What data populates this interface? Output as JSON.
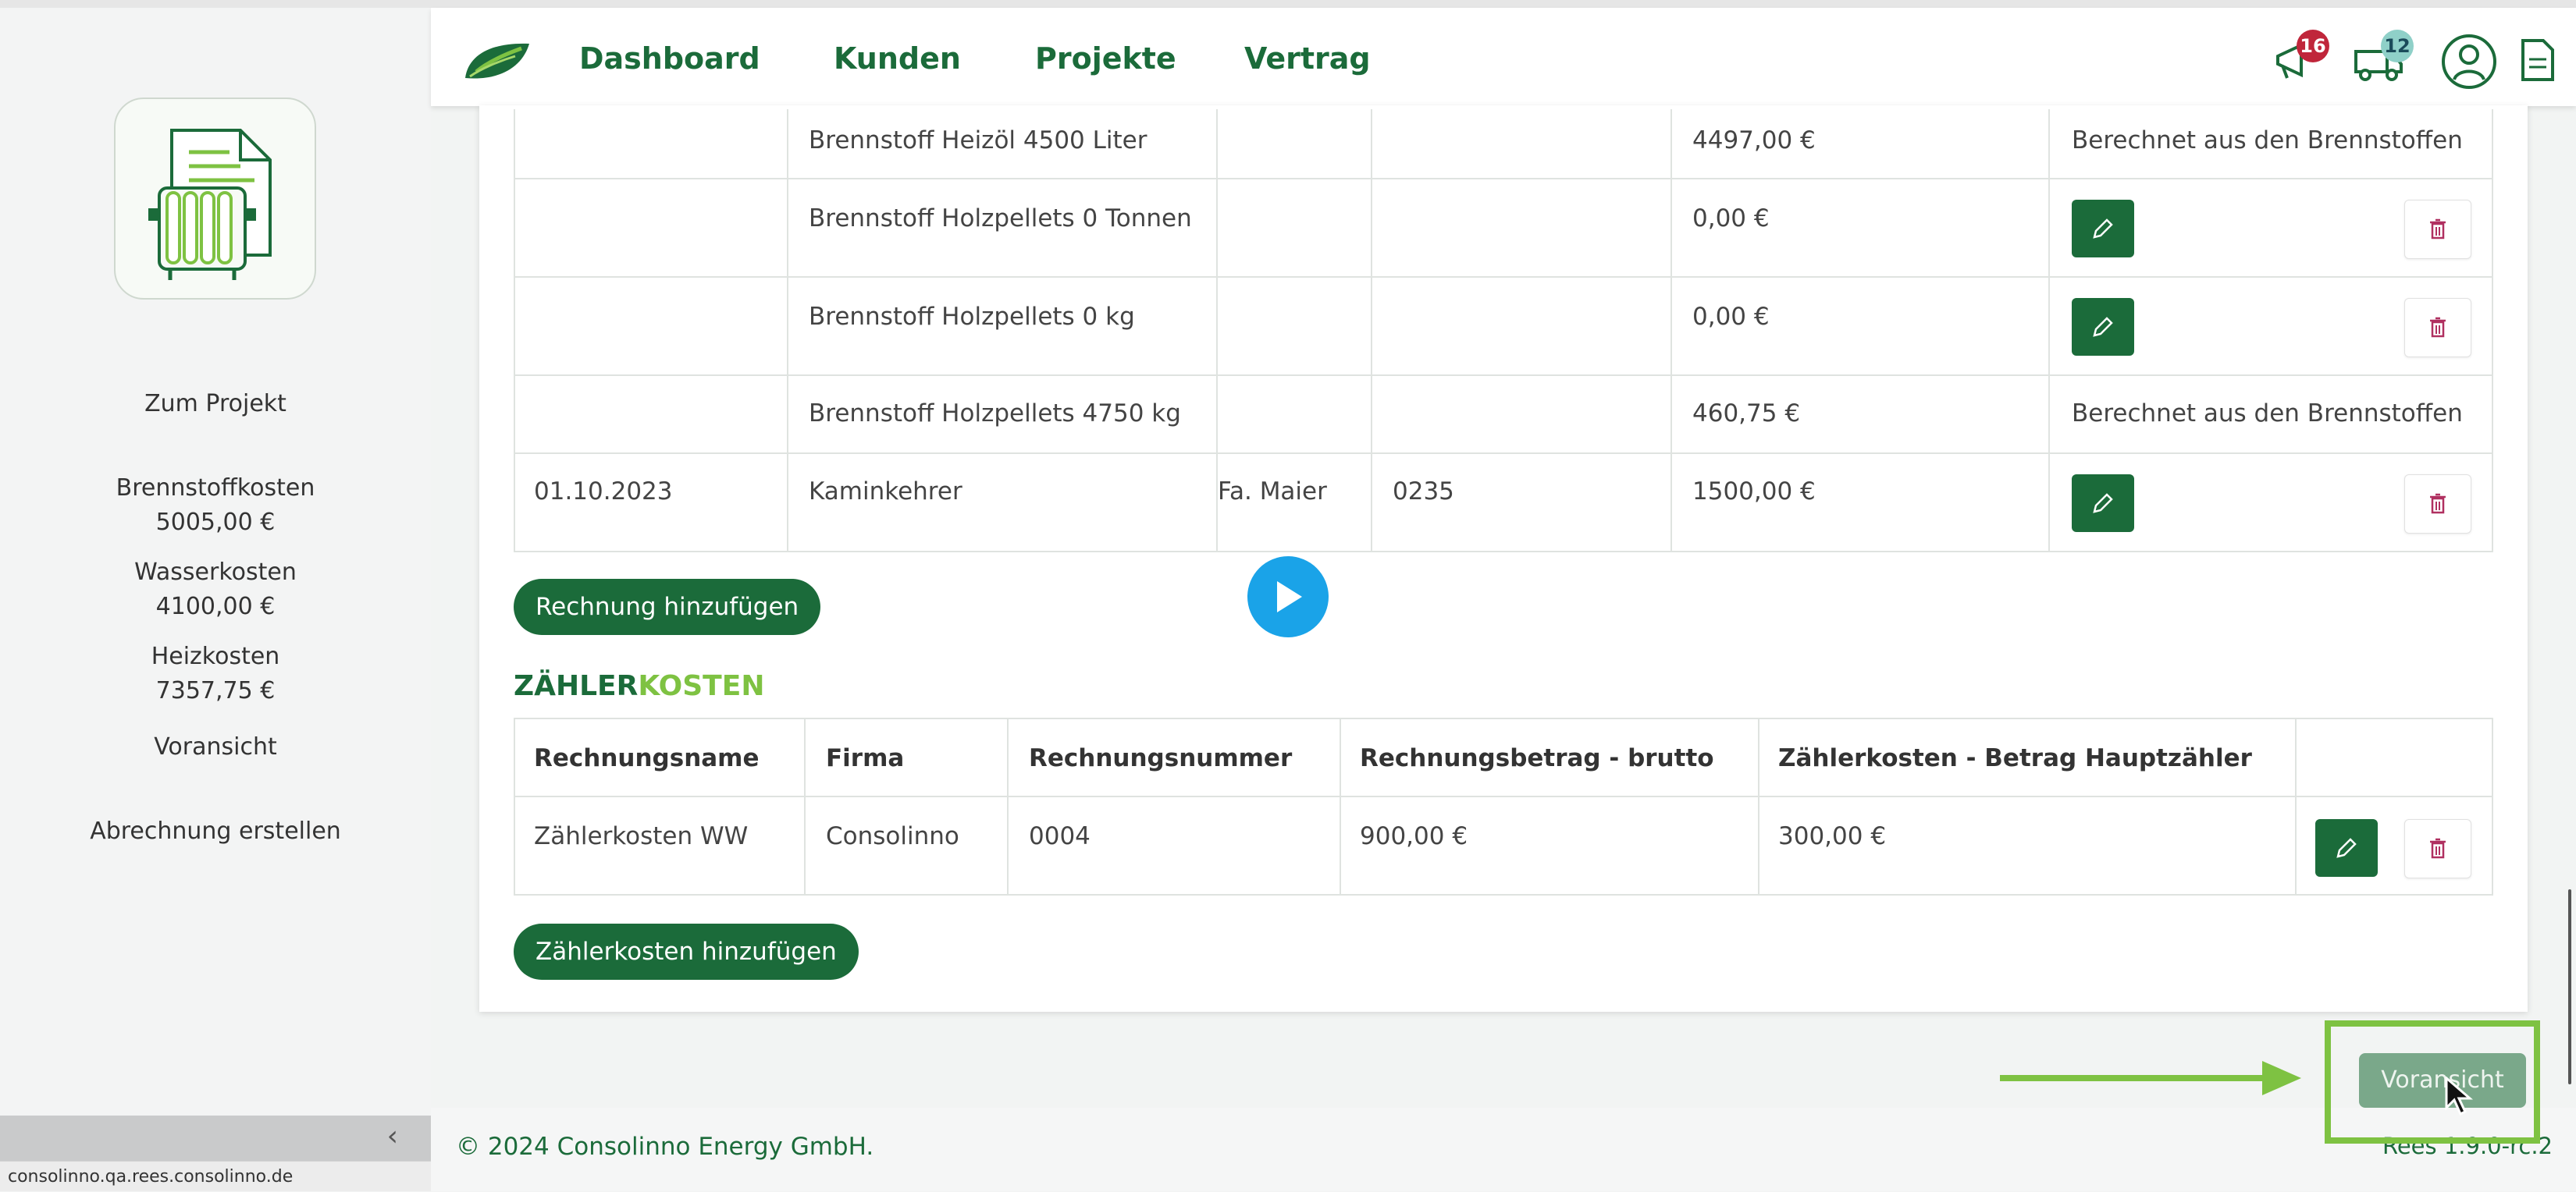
{
  "browser": {
    "status_url": "consolinno.qa.rees.consolinno.de"
  },
  "sidebar": {
    "items": [
      {
        "label": "Zum Projekt"
      },
      {
        "label": "Brennstoffkosten",
        "value": "5005,00 €"
      },
      {
        "label": "Wasserkosten",
        "value": "4100,00 €"
      },
      {
        "label": "Heizkosten",
        "value": "7357,75 €"
      },
      {
        "label": "Voransicht"
      },
      {
        "label": "Abrechnung erstellen"
      }
    ],
    "collapse_icon": "chevron-left-icon"
  },
  "navbar": {
    "links": [
      "Dashboard",
      "Kunden",
      "Projekte",
      "Vertrag"
    ],
    "notifications_count": "16",
    "tasks_count": "12",
    "colors": {
      "brand": "#1b6b3a",
      "accent": "#7ec242",
      "badge_red": "#c0263b",
      "badge_teal": "#5fb8b0"
    }
  },
  "invoices": {
    "rows": [
      {
        "date": "",
        "name": "Brennstoff Heizöl 4500 Liter",
        "firma": "",
        "nummer": "",
        "betrag": "4497,00 €",
        "note": "Berechnet aus den Brennstoffen",
        "editable": false
      },
      {
        "date": "",
        "name": "Brennstoff Holzpellets 0 Tonnen",
        "firma": "",
        "nummer": "",
        "betrag": "0,00 €",
        "note": "",
        "editable": true
      },
      {
        "date": "",
        "name": "Brennstoff Holzpellets 0 kg",
        "firma": "",
        "nummer": "",
        "betrag": "0,00 €",
        "note": "",
        "editable": true
      },
      {
        "date": "",
        "name": "Brennstoff Holzpellets 4750 kg",
        "firma": "",
        "nummer": "",
        "betrag": "460,75 €",
        "note": "Berechnet aus den Brennstoffen",
        "editable": false
      },
      {
        "date": "01.10.2023",
        "name": "Kaminkehrer",
        "firma": "Fa. Maier",
        "nummer": "0235",
        "betrag": "1500,00 €",
        "note": "",
        "editable": true
      }
    ],
    "add_button": "Rechnung hinzufügen"
  },
  "meter": {
    "title_a": "ZÄHLER",
    "title_b": "KOSTEN",
    "headers": [
      "Rechnungsname",
      "Firma",
      "Rechnungsnummer",
      "Rechnungsbetrag - brutto",
      "Zählerkosten - Betrag Hauptzähler"
    ],
    "rows": [
      {
        "name": "Zählerkosten WW",
        "firma": "Consolinno",
        "nummer": "0004",
        "betrag": "900,00 €",
        "haupt": "300,00 €"
      }
    ],
    "add_button": "Zählerkosten hinzufügen"
  },
  "actions": {
    "preview_button": "Voransicht"
  },
  "footer": {
    "copyright": "© 2024 Consolinno Energy GmbH.",
    "version": "Rees 1.9.0-rc.2"
  }
}
